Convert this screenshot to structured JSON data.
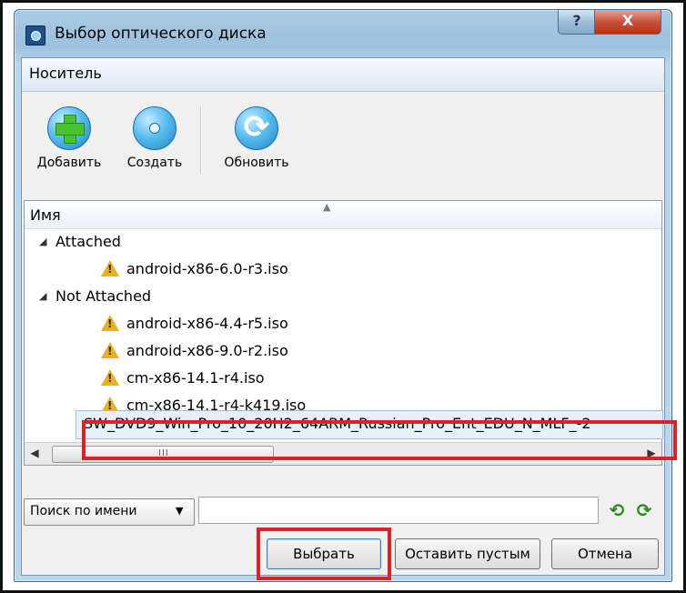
{
  "window": {
    "title": "Выбор оптического диска",
    "help_label": "?",
    "close_label": "X",
    "icon": "virtualbox-icon"
  },
  "menu": {
    "items": [
      {
        "label": "Носитель"
      }
    ]
  },
  "toolbar": {
    "add_label": "Добавить",
    "create_label": "Создать",
    "refresh_label": "Обновить",
    "icons": [
      "add-disk-icon",
      "create-disk-icon",
      "refresh-icon"
    ]
  },
  "list": {
    "column_header": "Имя",
    "groups": [
      {
        "name": "Attached",
        "items": [
          "android-x86-6.0-r3.iso"
        ]
      },
      {
        "name": "Not Attached",
        "items": [
          "android-x86-4.4-r5.iso",
          "android-x86-9.0-r2.iso",
          "cm-x86-14.1-r4.iso",
          "cm-x86-14.1-r4-k419.iso",
          "SW_DVD9_Win_Pro_10_20H2_64ARM_Russian_Pro_Ent_EDU_N_MLF_-2"
        ]
      }
    ],
    "selected": "SW_DVD9_Win_Pro_10_20H2_64ARM_Russian_Pro_Ent_EDU_N_MLF_-2",
    "scroll_grip": "III"
  },
  "search": {
    "mode_label": "Поиск по имени",
    "value": ""
  },
  "buttons": {
    "choose": "Выбрать",
    "leave_empty": "Оставить пустым",
    "cancel": "Отмена"
  },
  "colors": {
    "highlight": "#d9232b",
    "warning": "#e8b21c",
    "selection": "#e6f1fb"
  }
}
